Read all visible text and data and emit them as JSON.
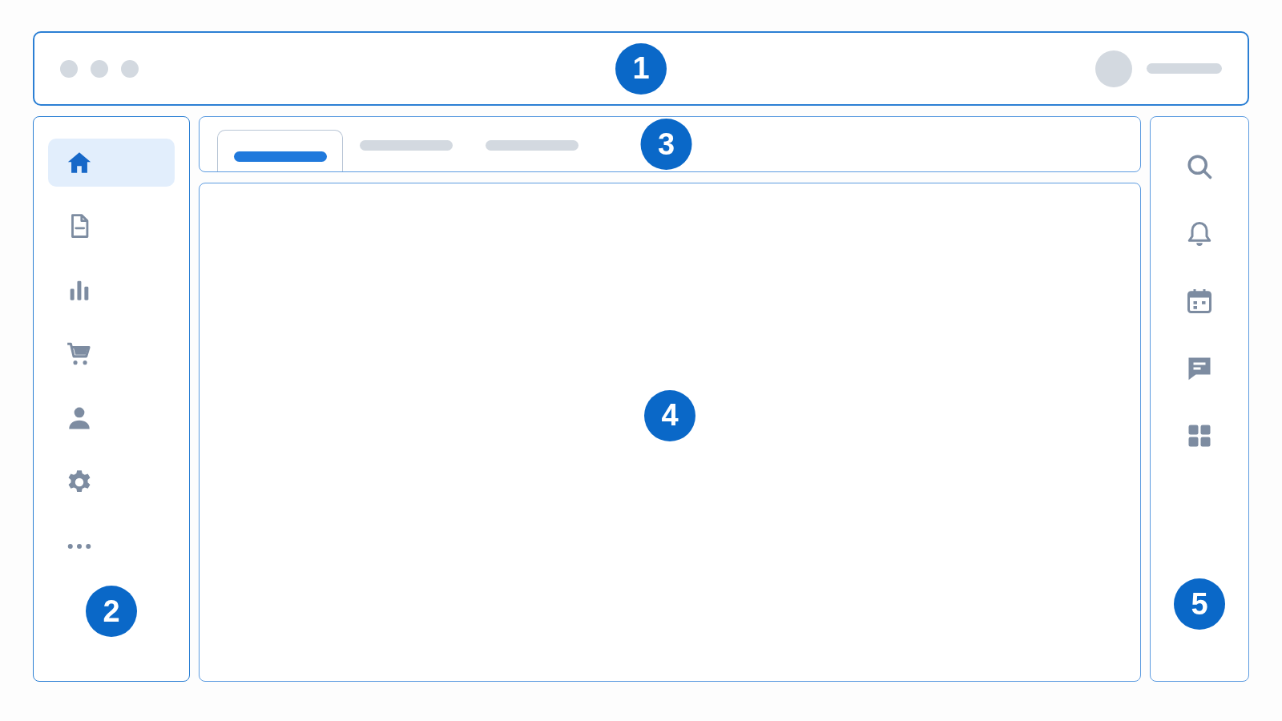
{
  "top_bar": {
    "badge": "1"
  },
  "sidebar": {
    "items": [
      {
        "selected": true
      },
      {
        "selected": false
      },
      {
        "selected": false
      },
      {
        "selected": false
      },
      {
        "selected": false
      },
      {
        "selected": false
      },
      {
        "selected": false
      }
    ],
    "badge": "2"
  },
  "tabs": {
    "items": [
      {
        "selected": true
      },
      {
        "selected": false
      },
      {
        "selected": false
      }
    ],
    "badge": "3"
  },
  "main": {
    "badge": "4"
  },
  "right_panel": {
    "badge": "5"
  }
}
